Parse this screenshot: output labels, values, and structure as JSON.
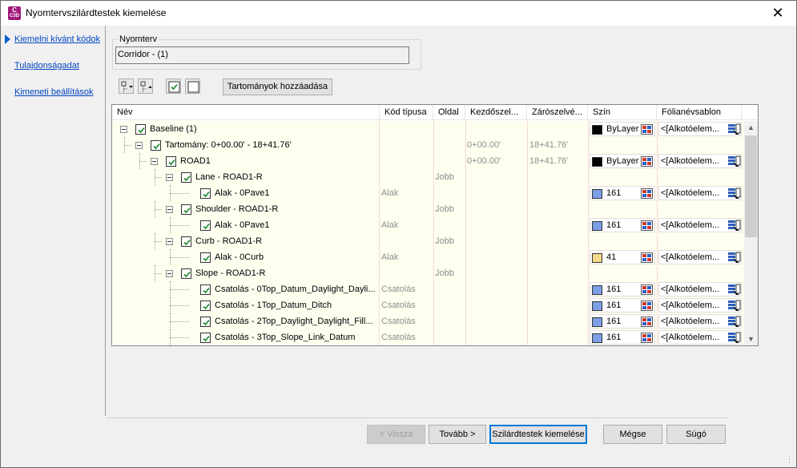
{
  "window": {
    "title": "Nyomtervszilárdtestek kiemelése",
    "close": "✕",
    "app_icon": {
      "top": "C",
      "bottom": "C3D"
    }
  },
  "sidebar": {
    "items": [
      {
        "label": "Kiemelni kívánt kódok"
      },
      {
        "label": "Tulajdonságadat"
      },
      {
        "label": "Kimeneti beállítások"
      }
    ]
  },
  "corridor_group": {
    "label": "Nyomterv",
    "value": "Corridor - (1)"
  },
  "toolbar": {
    "add_ranges_label": "Tartományok hozzáadása"
  },
  "grid": {
    "columns": [
      "Név",
      "Kód típusa",
      "Oldal",
      "Kezdőszel...",
      "Zárószelvé...",
      "Szín",
      "Fólianévsablon"
    ],
    "rows": [
      {
        "name": "Baseline (1)",
        "code_type": "",
        "side": "",
        "start": "",
        "end": "",
        "color_label": "ByLayer",
        "color": "#000000",
        "style": "<[Alkotóelem..."
      },
      {
        "name": "Tartomány: 0+00.00' - 18+41.76'",
        "code_type": "",
        "side": "",
        "start": "0+00.00'",
        "end": "18+41.76'",
        "color_label": "",
        "color": "",
        "style": ""
      },
      {
        "name": "ROAD1",
        "code_type": "",
        "side": "",
        "start": "0+00.00'",
        "end": "18+41.76'",
        "color_label": "ByLayer",
        "color": "#000000",
        "style": "<[Alkotóelem..."
      },
      {
        "name": "Lane - ROAD1-R",
        "code_type": "",
        "side": "Jobb",
        "start": "",
        "end": "",
        "color_label": "",
        "color": "",
        "style": ""
      },
      {
        "name": "Alak - 0Pave1",
        "code_type": "Alak",
        "side": "",
        "start": "",
        "end": "",
        "color_label": "161",
        "color": "#7b9ee6",
        "style": "<[Alkotóelem..."
      },
      {
        "name": "Shoulder - ROAD1-R",
        "code_type": "",
        "side": "Jobb",
        "start": "",
        "end": "",
        "color_label": "",
        "color": "",
        "style": ""
      },
      {
        "name": "Alak - 0Pave1",
        "code_type": "Alak",
        "side": "",
        "start": "",
        "end": "",
        "color_label": "161",
        "color": "#7b9ee6",
        "style": "<[Alkotóelem..."
      },
      {
        "name": "Curb - ROAD1-R",
        "code_type": "",
        "side": "Jobb",
        "start": "",
        "end": "",
        "color_label": "",
        "color": "",
        "style": ""
      },
      {
        "name": "Alak - 0Curb",
        "code_type": "Alak",
        "side": "",
        "start": "",
        "end": "",
        "color_label": "41",
        "color": "#f7d98c",
        "style": "<[Alkotóelem..."
      },
      {
        "name": "Slope - ROAD1-R",
        "code_type": "",
        "side": "Jobb",
        "start": "",
        "end": "",
        "color_label": "",
        "color": "",
        "style": ""
      },
      {
        "name": "Csatolás - 0Top_Datum_Daylight_Dayli...",
        "code_type": "Csatolás",
        "side": "",
        "start": "",
        "end": "",
        "color_label": "161",
        "color": "#7b9ee6",
        "style": "<[Alkotóelem..."
      },
      {
        "name": "Csatolás - 1Top_Datum_Ditch",
        "code_type": "Csatolás",
        "side": "",
        "start": "",
        "end": "",
        "color_label": "161",
        "color": "#7b9ee6",
        "style": "<[Alkotóelem..."
      },
      {
        "name": "Csatolás - 2Top_Daylight_Daylight_Fill...",
        "code_type": "Csatolás",
        "side": "",
        "start": "",
        "end": "",
        "color_label": "161",
        "color": "#7b9ee6",
        "style": "<[Alkotóelem..."
      },
      {
        "name": "Csatolás - 3Top_Slope_Link_Datum",
        "code_type": "Csatolás",
        "side": "",
        "start": "",
        "end": "",
        "color_label": "161",
        "color": "#7b9ee6",
        "style": "<[Alkotóelem..."
      }
    ]
  },
  "buttons": {
    "back": "< Vissza",
    "next": "Tovább >",
    "extract": "Szilárdtestek kiemelése",
    "cancel": "Mégse",
    "help": "Súgó"
  }
}
